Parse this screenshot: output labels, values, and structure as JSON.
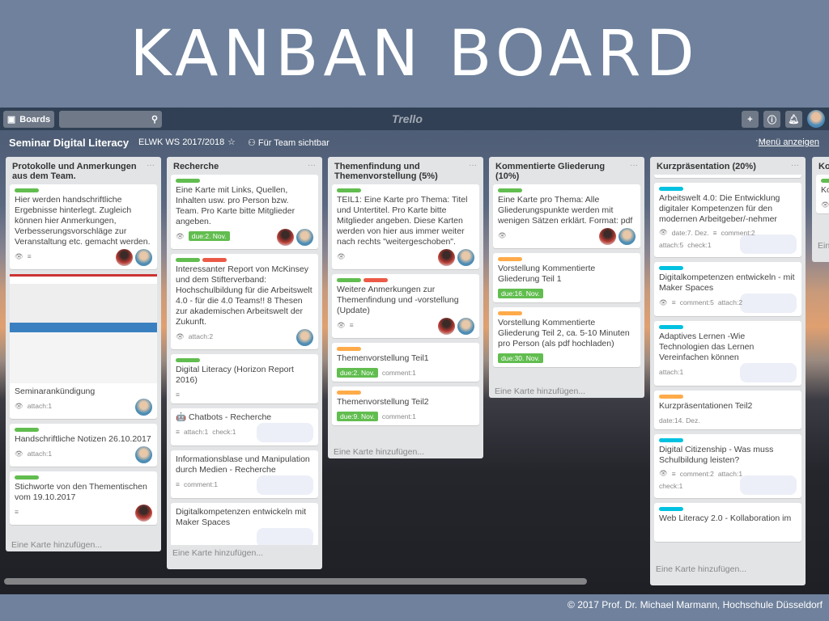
{
  "slide": {
    "title": "KANBAN BOARD",
    "copyright": "© 2017 Prof. Dr. Michael Marmann, Hochschule Düsseldorf"
  },
  "topbar": {
    "boards_label": "Boards",
    "logo": "Trello",
    "icons": [
      "board-icon",
      "search-icon",
      "plus-icon",
      "info-icon",
      "bell-icon"
    ]
  },
  "board": {
    "name": "Seminar Digital Literacy",
    "org": "ELWK WS 2017/2018",
    "visibility": "Für Team sichtbar",
    "menu": "Menü anzeigen",
    "add_card": "Eine Karte hinzufügen..."
  },
  "colors": {
    "green": "#61bd4f",
    "red": "#eb5a46",
    "orange": "#ffab4a",
    "blue": "#00c2e0"
  },
  "lists": [
    {
      "title": "Protokolle und Anmerkungen aus dem Team.",
      "cards": [
        {
          "labels": [
            "green"
          ],
          "text": "Hier werden handschriftliche Ergebnisse hinterlegt. Zugleich können hier Anmerkungen, Verbesserungsvorschläge zur Veranstaltung etc. gemacht werden.",
          "badges": [
            "eye",
            "desc"
          ],
          "members": [
            "a",
            "b"
          ]
        },
        {
          "cover": true,
          "text": "Seminarankündigung",
          "badges": [
            "eye",
            "attach:1"
          ],
          "members": [
            "b"
          ]
        },
        {
          "labels": [
            "green"
          ],
          "text": "Handschriftliche Notizen 26.10.2017",
          "badges": [
            "eye",
            "attach:1"
          ],
          "members": [
            "b"
          ]
        },
        {
          "labels": [
            "green"
          ],
          "text": "Stichworte von den Thementischen vom 19.10.2017",
          "badges": [
            "desc"
          ],
          "members": [
            "a"
          ]
        }
      ]
    },
    {
      "title": "Recherche",
      "cards": [
        {
          "labels": [
            "green"
          ],
          "text": "Eine Karte mit Links, Quellen, Inhalten usw. pro Person bzw. Team. Pro Karte bitte Mitglieder angeben.",
          "badges": [
            "eye",
            "due:2. Nov."
          ],
          "members": [
            "a",
            "b"
          ]
        },
        {
          "labels": [
            "green",
            "red"
          ],
          "text": "Interessanter Report von McKinsey und dem Stifterverband: Hochschulbildung für die Arbeitswelt 4.0 - für die 4.0 Teams!! 8 Thesen zur akademischen Arbeitswelt der Zukunft.",
          "badges": [
            "eye",
            "attach:2"
          ],
          "members": [
            "b"
          ]
        },
        {
          "labels": [
            "green"
          ],
          "text": "Digital Literacy (Horizon Report 2016)",
          "badges": [
            "desc"
          ]
        },
        {
          "text": "🤖 Chatbots - Recherche",
          "badges": [
            "desc",
            "attach:1",
            "check:1"
          ],
          "faded": true
        },
        {
          "text": "Informationsblase und Manipulation durch Medien - Recherche",
          "badges": [
            "desc",
            "comment:1"
          ],
          "faded": true
        },
        {
          "text": "Digitalkompetenzen entwickeln mit Maker Spaces",
          "badges": [],
          "faded": true
        }
      ]
    },
    {
      "title": "Themenfindung und Themenvorstellung (5%)",
      "cards": [
        {
          "labels": [
            "green"
          ],
          "text": "TEIL1: Eine Karte pro Thema: Titel und Untertitel. Pro Karte bitte Mitglieder angeben. Diese Karten werden von hier aus immer weiter nach rechts \"weitergeschoben\".",
          "badges": [
            "eye"
          ],
          "members": [
            "a",
            "b"
          ]
        },
        {
          "labels": [
            "green",
            "red"
          ],
          "text": "Weitere Anmerkungen zur Themenfindung und -vorstellung (Update)",
          "badges": [
            "eye",
            "desc"
          ],
          "members": [
            "a",
            "b"
          ]
        },
        {
          "labels": [
            "orange"
          ],
          "text": "Themenvorstellung Teil1",
          "badges": [
            "due:2. Nov.",
            "comment:1"
          ]
        },
        {
          "labels": [
            "orange"
          ],
          "text": "Themenvorstellung Teil2",
          "badges": [
            "due:9. Nov.",
            "comment:1"
          ]
        }
      ]
    },
    {
      "title": "Kommentierte Gliederung (10%)",
      "cards": [
        {
          "labels": [
            "green"
          ],
          "text": "Eine Karte pro Thema: Alle Gliederungspunkte werden mit wenigen Sätzen erklärt. Format: pdf",
          "badges": [
            "eye"
          ],
          "members": [
            "a",
            "b"
          ]
        },
        {
          "labels": [
            "orange"
          ],
          "text": "Vorstellung Kommentierte Gliederung Teil 1",
          "badges": [
            "due:16. Nov."
          ]
        },
        {
          "labels": [
            "orange"
          ],
          "text": "Vorstellung Kommentierte Gliederung Teil 2, ca. 5-10 Minuten pro Person (als pdf hochladen)",
          "badges": [
            "due:30. Nov."
          ]
        }
      ]
    },
    {
      "title": "Kurzpräsentation (20%)",
      "cards": [
        {
          "cut": true,
          "text": "",
          "badges": []
        },
        {
          "labels": [
            "blue"
          ],
          "text": "Arbeitswelt 4.0: Die Entwicklung digitaler Kompetenzen für den modernen Arbeitgeber/-nehmer",
          "badges": [
            "eye",
            "date:7. Dez.",
            "desc",
            "comment:2",
            "attach:5",
            "check:1"
          ],
          "faded": true
        },
        {
          "labels": [
            "blue"
          ],
          "text": "Digitalkompetenzen entwickeln - mit Maker Spaces",
          "badges": [
            "eye",
            "desc",
            "comment:5",
            "attach:2"
          ],
          "faded": true
        },
        {
          "labels": [
            "blue"
          ],
          "text": "Adaptives Lernen -Wie Technologien das Lernen Vereinfachen können",
          "badges": [
            "attach:1"
          ],
          "faded": true
        },
        {
          "labels": [
            "orange"
          ],
          "text": "Kurzpräsentationen Teil2",
          "badges": [
            "date:14. Dez."
          ]
        },
        {
          "labels": [
            "blue"
          ],
          "text": "Digital Citizenship - Was muss Schulbildung leisten?",
          "badges": [
            "eye",
            "desc",
            "comment:2",
            "attach:1",
            "check:1"
          ],
          "faded": true
        },
        {
          "labels": [
            "blue"
          ],
          "text": "Web Literacy 2.0 - Kollaboration im",
          "badges": []
        }
      ]
    },
    {
      "title": "Ko… Ku…",
      "cards": [
        {
          "labels": [
            "green"
          ],
          "text": "Ko Ku Ko Er",
          "badges": [
            "eye"
          ]
        }
      ]
    }
  ]
}
